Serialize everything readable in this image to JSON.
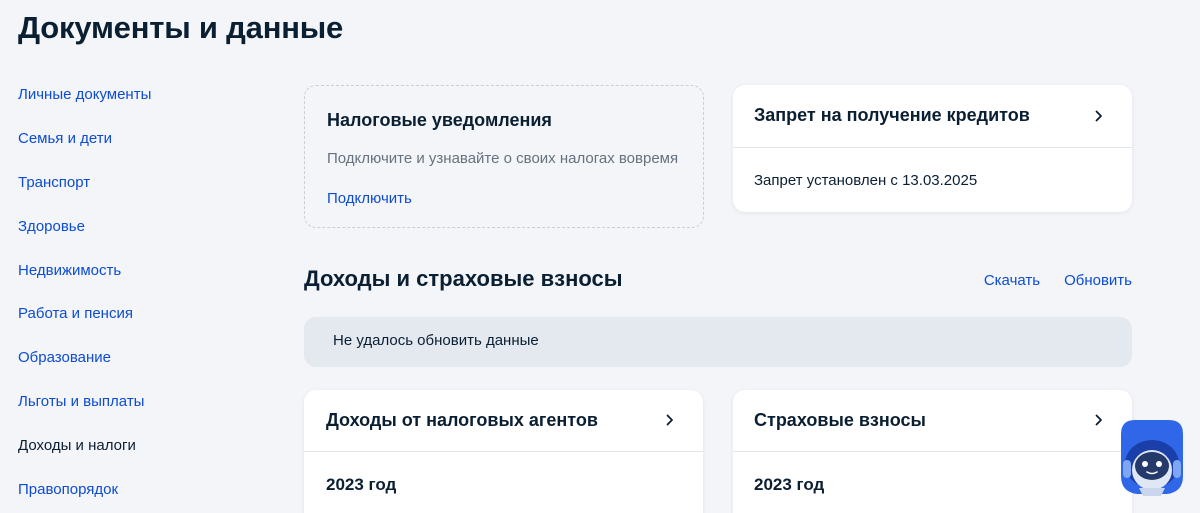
{
  "page": {
    "title": "Документы и данные"
  },
  "sidebar": {
    "items": [
      {
        "label": "Личные документы",
        "active": false
      },
      {
        "label": "Семья и дети",
        "active": false
      },
      {
        "label": "Транспорт",
        "active": false
      },
      {
        "label": "Здоровье",
        "active": false
      },
      {
        "label": "Недвижимость",
        "active": false
      },
      {
        "label": "Работа и пенсия",
        "active": false
      },
      {
        "label": "Образование",
        "active": false
      },
      {
        "label": "Льготы и выплаты",
        "active": false
      },
      {
        "label": "Доходы и налоги",
        "active": true
      },
      {
        "label": "Правопорядок",
        "active": false
      }
    ]
  },
  "tax_notifications": {
    "title": "Налоговые уведомления",
    "description": "Подключите и узнавайте о своих налогах вовремя",
    "action": "Подключить"
  },
  "credit_ban": {
    "title": "Запрет на получение кредитов",
    "status": "Запрет установлен с 13.03.2025"
  },
  "income_section": {
    "title": "Доходы и страховые взносы",
    "download": "Скачать",
    "refresh": "Обновить",
    "error": "Не удалось обновить данные"
  },
  "income_cards": [
    {
      "title": "Доходы от налоговых агентов",
      "year": "2023 год"
    },
    {
      "title": "Страховые взносы",
      "year": "2023 год"
    }
  ],
  "colors": {
    "accent": "#0d4cd3",
    "text": "#0b1f33",
    "muted": "#66727f",
    "background": "#f3f5f8",
    "alert_bg": "#e4e9f0"
  },
  "icons": {
    "chevron": "chevron-right-icon",
    "assistant": "robot-assistant-icon"
  }
}
